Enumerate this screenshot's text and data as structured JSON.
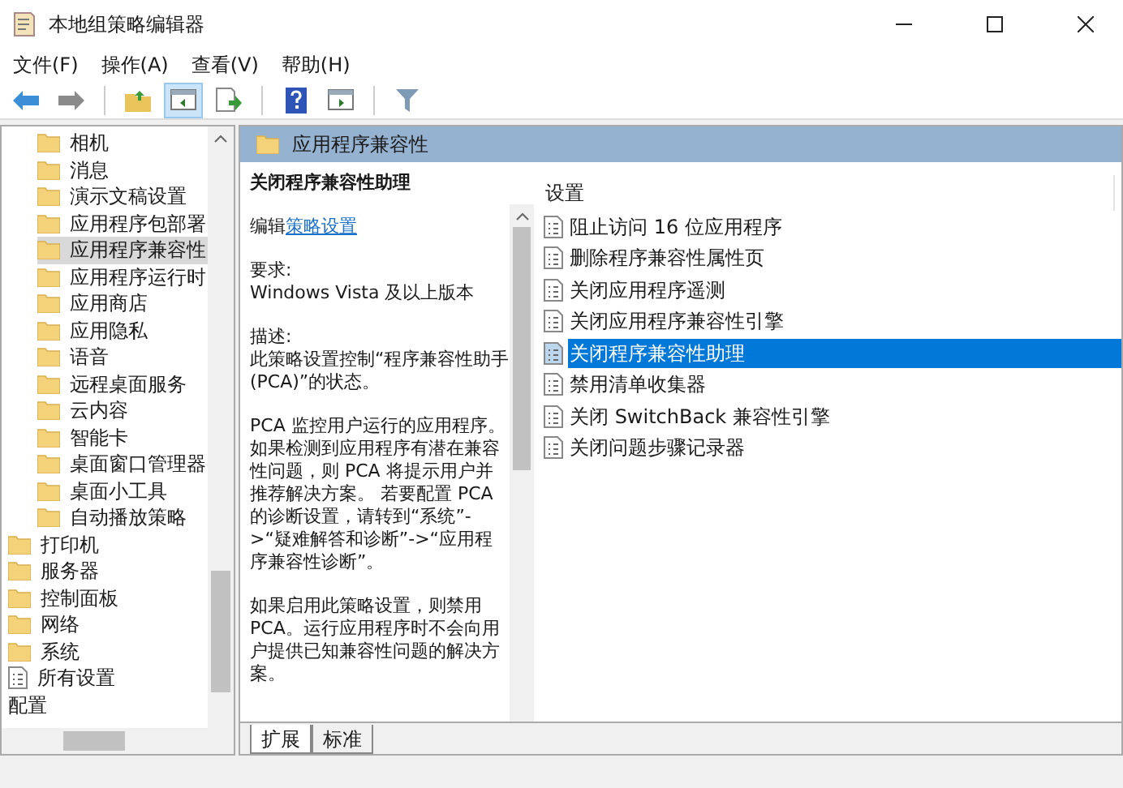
{
  "window": {
    "title": "本地组策略编辑器"
  },
  "menu": [
    "文件(F)",
    "操作(A)",
    "查看(V)",
    "帮助(H)"
  ],
  "toolbar": [
    {
      "kind": "back",
      "selected": false
    },
    {
      "kind": "forward",
      "selected": false
    },
    {
      "kind": "sep"
    },
    {
      "kind": "up",
      "selected": false
    },
    {
      "kind": "pane",
      "selected": true
    },
    {
      "kind": "export",
      "selected": false
    },
    {
      "kind": "sep"
    },
    {
      "kind": "help",
      "selected": false
    },
    {
      "kind": "pane2",
      "selected": false
    },
    {
      "kind": "sep"
    },
    {
      "kind": "filter",
      "selected": false
    }
  ],
  "tree": [
    {
      "children": [
        {
          "label": "相机",
          "kind": "folder",
          "selected": false
        },
        {
          "label": "消息",
          "kind": "folder",
          "selected": false
        },
        {
          "label": "演示文稿设置",
          "kind": "folder",
          "selected": false
        },
        {
          "label": "应用程序包部署",
          "kind": "folder",
          "selected": false
        },
        {
          "label": "应用程序兼容性",
          "kind": "folder",
          "selected": true
        },
        {
          "label": "应用程序运行时",
          "kind": "folder",
          "selected": false
        },
        {
          "label": "应用商店",
          "kind": "folder",
          "selected": false
        },
        {
          "label": "应用隐私",
          "kind": "folder",
          "selected": false
        },
        {
          "label": "语音",
          "kind": "folder",
          "selected": false
        },
        {
          "label": "远程桌面服务",
          "kind": "folder",
          "selected": false
        },
        {
          "label": "云内容",
          "kind": "folder",
          "selected": false
        },
        {
          "label": "智能卡",
          "kind": "folder",
          "selected": false
        },
        {
          "label": "桌面窗口管理器",
          "kind": "folder",
          "selected": false
        },
        {
          "label": "桌面小工具",
          "kind": "folder",
          "selected": false
        },
        {
          "label": "自动播放策略",
          "kind": "folder",
          "selected": false
        }
      ]
    },
    {
      "label": "打印机",
      "kind": "folder",
      "selected": false
    },
    {
      "label": "服务器",
      "kind": "folder",
      "selected": false
    },
    {
      "label": "控制面板",
      "kind": "folder",
      "selected": false
    },
    {
      "label": "网络",
      "kind": "folder",
      "selected": false
    },
    {
      "label": "系统",
      "kind": "folder",
      "selected": false
    },
    {
      "label": "所有设置",
      "kind": "document",
      "selected": false
    },
    {
      "label": "配置",
      "kind": "none",
      "selected": false
    }
  ],
  "header": {
    "title": "应用程序兼容性"
  },
  "description": {
    "title": "关闭程序兼容性助理",
    "edit_prefix": "编辑",
    "edit_link": "策略设置",
    "requirements_label": "要求:",
    "requirements": "Windows Vista 及以上版本",
    "description_label": "描述:",
    "paragraphs": [
      "此策略设置控制“程序兼容性助手(PCA)”的状态。",
      "PCA 监控用户运行的应用程序。如果检测到应用程序有潜在兼容性问题，则 PCA 将提示用户并推荐解决方案。 若要配置 PCA 的诊断设置，请转到“系统”->“疑难解答和诊断”->“应用程序兼容性诊断”。",
      "如果启用此策略设置，则禁用 PCA。运行应用程序时不会向用户提供已知兼容性问题的解决方案。"
    ]
  },
  "settings": {
    "column": "设置",
    "items": [
      {
        "label": "阻止访问 16 位应用程序",
        "selected": false
      },
      {
        "label": "删除程序兼容性属性页",
        "selected": false
      },
      {
        "label": "关闭应用程序遥测",
        "selected": false
      },
      {
        "label": "关闭应用程序兼容性引擎",
        "selected": false
      },
      {
        "label": "关闭程序兼容性助理",
        "selected": true
      },
      {
        "label": "禁用清单收集器",
        "selected": false
      },
      {
        "label": "关闭 SwitchBack 兼容性引擎",
        "selected": false
      },
      {
        "label": "关闭问题步骤记录器",
        "selected": false
      }
    ]
  },
  "tabs": [
    {
      "label": "扩展",
      "selected": true
    },
    {
      "label": "标准",
      "selected": false
    }
  ]
}
